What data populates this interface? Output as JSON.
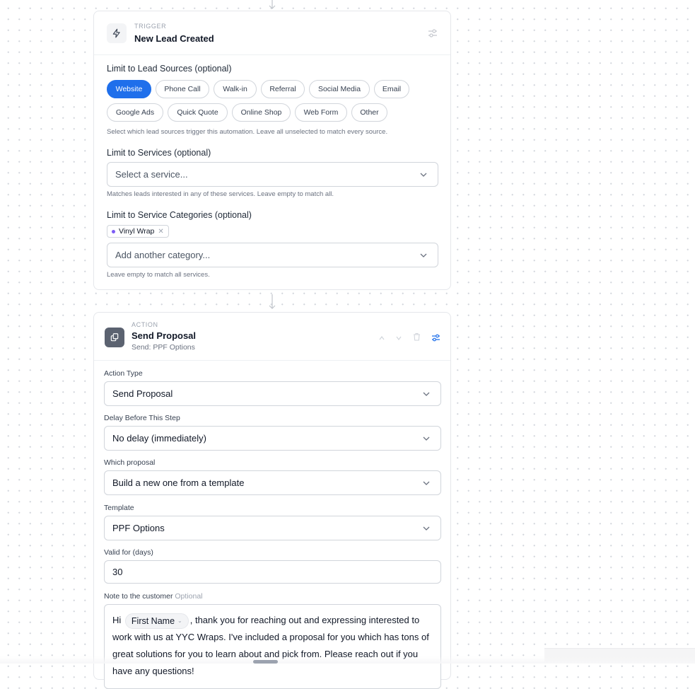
{
  "colors": {
    "accent": "#1f6feb",
    "category_dot": "#7c5cf5"
  },
  "trigger": {
    "kicker": "TRIGGER",
    "title": "New Lead Created",
    "icon": "lightning-icon",
    "settings_icon": "sliders-icon",
    "lead_sources_label": "Limit to Lead Sources (optional)",
    "lead_sources": [
      {
        "label": "Website",
        "selected": true
      },
      {
        "label": "Phone Call",
        "selected": false
      },
      {
        "label": "Walk-in",
        "selected": false
      },
      {
        "label": "Referral",
        "selected": false
      },
      {
        "label": "Social Media",
        "selected": false
      },
      {
        "label": "Email",
        "selected": false
      },
      {
        "label": "Google Ads",
        "selected": false
      },
      {
        "label": "Quick Quote",
        "selected": false
      },
      {
        "label": "Online Shop",
        "selected": false
      },
      {
        "label": "Web Form",
        "selected": false
      },
      {
        "label": "Other",
        "selected": false
      }
    ],
    "lead_sources_help": "Select which lead sources trigger this automation. Leave all unselected to match every source.",
    "services_label": "Limit to Services (optional)",
    "services_placeholder": "Select a service...",
    "services_help": "Matches leads interested in any of these services. Leave empty to match all.",
    "categories_label": "Limit to Service Categories (optional)",
    "category_tags": [
      "Vinyl Wrap"
    ],
    "categories_placeholder": "Add another category...",
    "categories_help": "Leave empty to match all services."
  },
  "action": {
    "kicker": "ACTION",
    "title": "Send Proposal",
    "subtitle": "Send: PPF Options",
    "icon": "proposal-icon",
    "fields": {
      "action_type": {
        "label": "Action Type",
        "value": "Send Proposal"
      },
      "delay": {
        "label": "Delay Before This Step",
        "value": "No delay (immediately)"
      },
      "which_proposal": {
        "label": "Which proposal",
        "value": "Build a new one from a template"
      },
      "template": {
        "label": "Template",
        "value": "PPF Options"
      },
      "valid_for": {
        "label": "Valid for (days)",
        "value": "30"
      }
    },
    "note": {
      "label": "Note to the customer",
      "optional": "Optional",
      "greeting": "Hi",
      "variable": "First Name",
      "body": ", thank you for reaching out and expressing interested to work with us at YYC Wraps. I've included a proposal for you which has tons of great solutions for you to learn about and pick from. Please reach out if you have any questions!"
    }
  }
}
